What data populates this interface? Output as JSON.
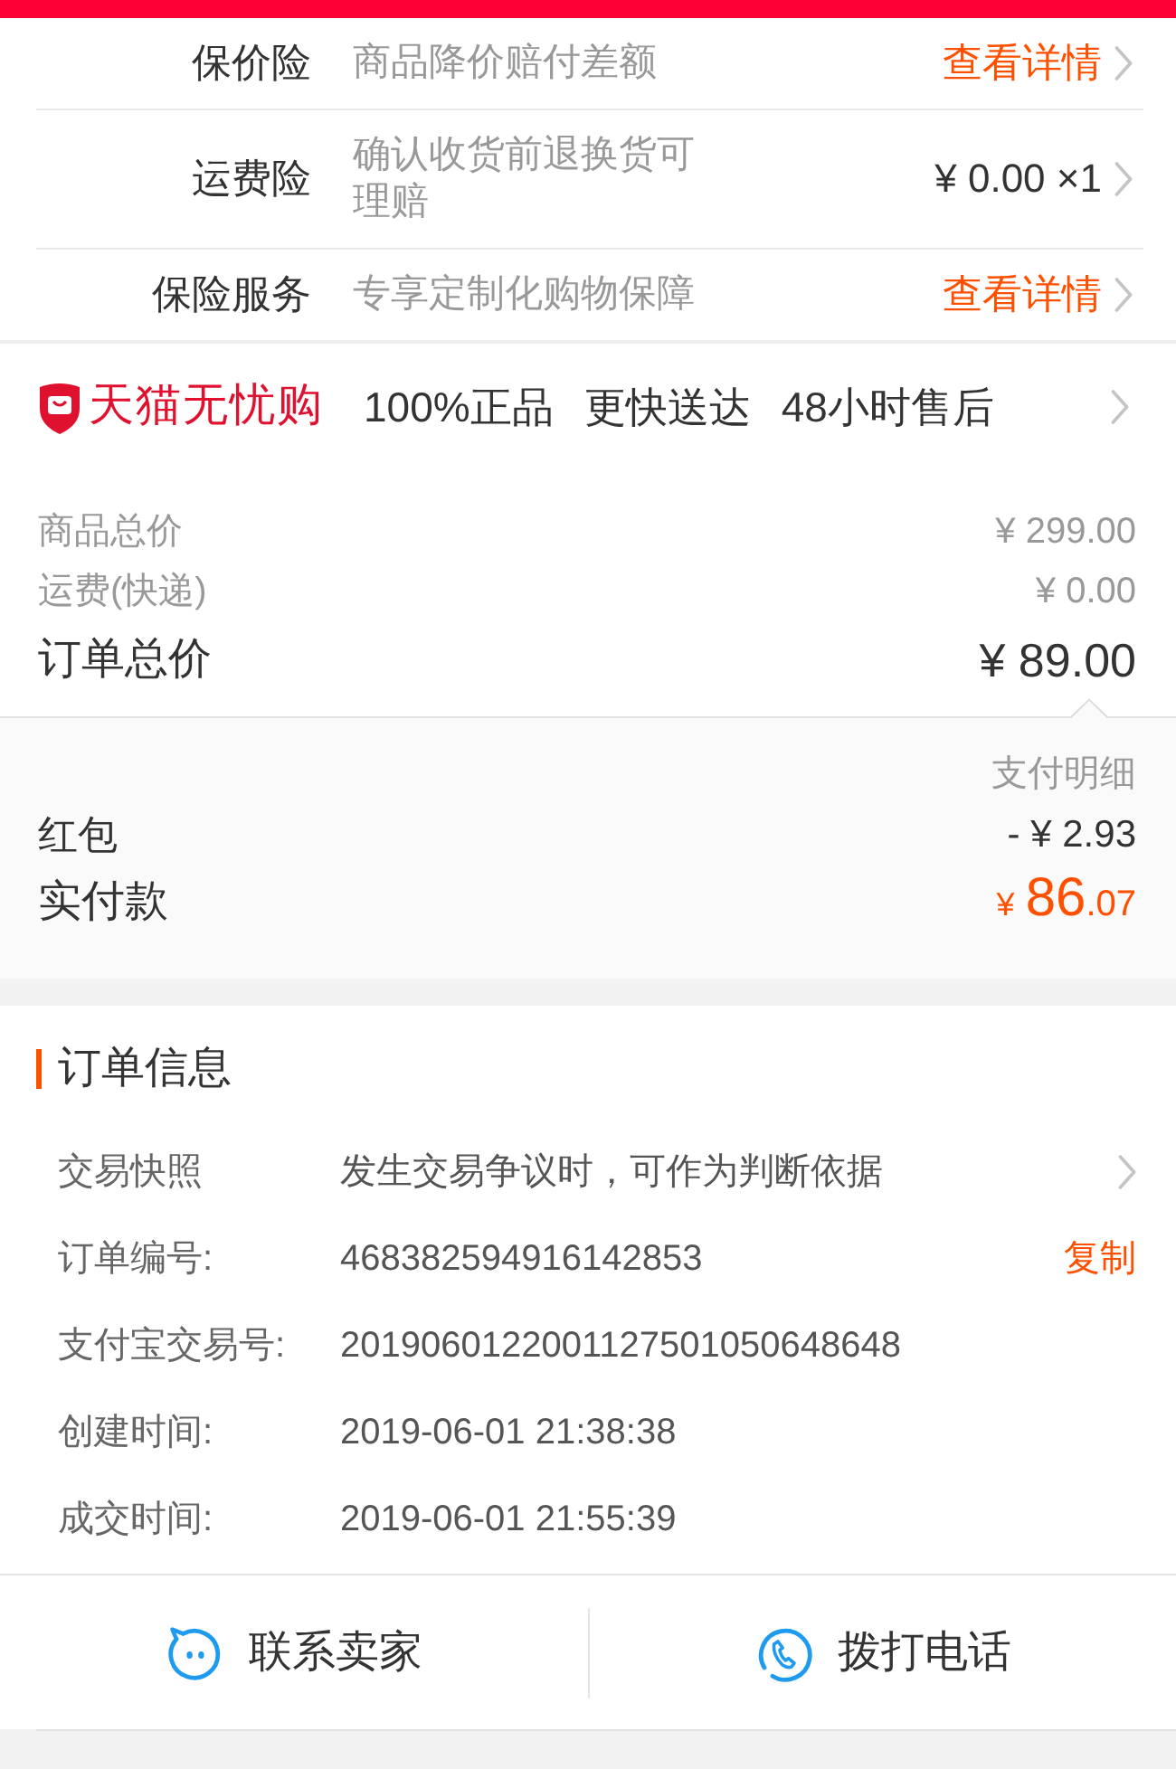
{
  "insurance": [
    {
      "label": "保价险",
      "description": "商品降价赔付差额",
      "action": "查看详情",
      "kind": "link"
    },
    {
      "label": "运费险",
      "description": "确认收货前退换货可理赔",
      "value": "¥ 0.00 ×1",
      "kind": "value"
    },
    {
      "label": "保险服务",
      "description": "专享定制化购物保障",
      "action": "查看详情",
      "kind": "link"
    }
  ],
  "guarantee": {
    "brand": "天猫无忧购",
    "features": [
      "100%正品",
      "更快送达",
      "48小时售后"
    ]
  },
  "price_summary": [
    {
      "label": "商品总价",
      "value": "¥ 299.00",
      "kind": "minor"
    },
    {
      "label": "运费(快递)",
      "value": "¥ 0.00",
      "kind": "minor"
    },
    {
      "label": "订单总价",
      "value": "¥ 89.00",
      "kind": "total"
    }
  ],
  "payment_detail": {
    "title": "支付明细",
    "rows": [
      {
        "label": "红包",
        "value": "- ¥ 2.93",
        "kind": "deduction"
      },
      {
        "label": "实付款",
        "currency": "¥",
        "integer": "86",
        "decimal": ".07",
        "kind": "paid"
      }
    ]
  },
  "order_info": {
    "title": "订单信息",
    "rows": [
      {
        "label": "交易快照",
        "value": "发生交易争议时，可作为判断依据",
        "kind": "link"
      },
      {
        "label": "订单编号:",
        "value": "468382594916142853",
        "action": "复制",
        "kind": "copy"
      },
      {
        "label": "支付宝交易号:",
        "value": "2019060122001127501050648648",
        "kind": "plain"
      },
      {
        "label": "创建时间:",
        "value": "2019-06-01 21:38:38",
        "kind": "plain"
      },
      {
        "label": "成交时间:",
        "value": "2019-06-01 21:55:39",
        "kind": "plain"
      }
    ]
  },
  "actions": [
    {
      "label": "联系卖家",
      "kind": "chat"
    },
    {
      "label": "拨打电话",
      "kind": "phone"
    }
  ]
}
